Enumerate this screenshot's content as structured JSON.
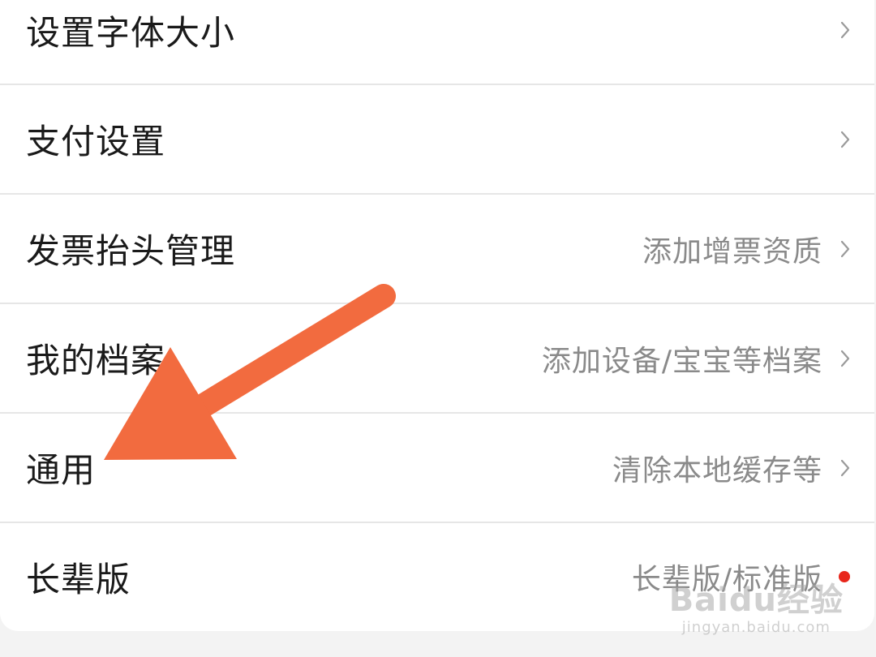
{
  "settings": {
    "items": [
      {
        "label": "设置字体大小",
        "value": ""
      },
      {
        "label": "支付设置",
        "value": ""
      },
      {
        "label": "发票抬头管理",
        "value": "添加增票资质"
      },
      {
        "label": "我的档案",
        "value": "添加设备/宝宝等档案"
      },
      {
        "label": "通用",
        "value": "清除本地缓存等"
      },
      {
        "label": "长辈版",
        "value": "长辈版/标准版"
      }
    ]
  },
  "annotation": {
    "arrow_color": "#f26b3f"
  },
  "watermark": {
    "main": "Baidu经验",
    "sub": "jingyan.baidu.com"
  },
  "colors": {
    "badge_dot": "#e8261b"
  }
}
